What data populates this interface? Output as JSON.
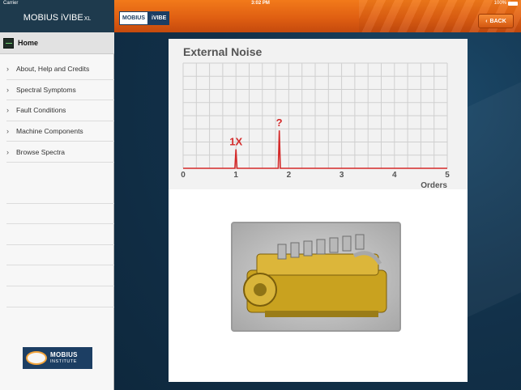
{
  "status_bar": {
    "carrier": "Carrier",
    "time": "3:02 PM",
    "battery": "100%"
  },
  "sidebar": {
    "title": "MOBIUS iVIBE",
    "title_suffix": "XL",
    "home_label": "Home",
    "items": [
      {
        "label": "About, Help and Credits"
      },
      {
        "label": "Spectral Symptoms"
      },
      {
        "label": "Fault Conditions"
      },
      {
        "label": "Machine Components"
      },
      {
        "label": "Browse Spectra"
      }
    ],
    "logo": {
      "line1": "MOBIUS",
      "line2": "INSTITUTE"
    }
  },
  "topbar": {
    "logo_left": "MOBIUS",
    "logo_right": "iVIBE",
    "back_label": "BACK",
    "accent": "#e8681a"
  },
  "chart_data": {
    "type": "line",
    "title": "External Noise",
    "xlabel": "Orders",
    "ylabel": "",
    "xlim": [
      0,
      5
    ],
    "ylim": [
      0,
      10
    ],
    "x_ticks": [
      "0",
      "1",
      "2",
      "3",
      "4",
      "5"
    ],
    "grid": true,
    "series": [
      {
        "values": [
          [
            0,
            0
          ],
          [
            0.98,
            0
          ],
          [
            1.0,
            1.8
          ],
          [
            1.02,
            0
          ],
          [
            1.8,
            0
          ],
          [
            1.82,
            3.6
          ],
          [
            1.84,
            0
          ],
          [
            5,
            0
          ]
        ],
        "color": "#d42a2a"
      }
    ],
    "annotations": [
      {
        "text": "1X",
        "x": 1.0
      },
      {
        "text": "?",
        "x": 1.82
      }
    ]
  },
  "engine_image": {
    "icon": "diesel-engine-image"
  }
}
